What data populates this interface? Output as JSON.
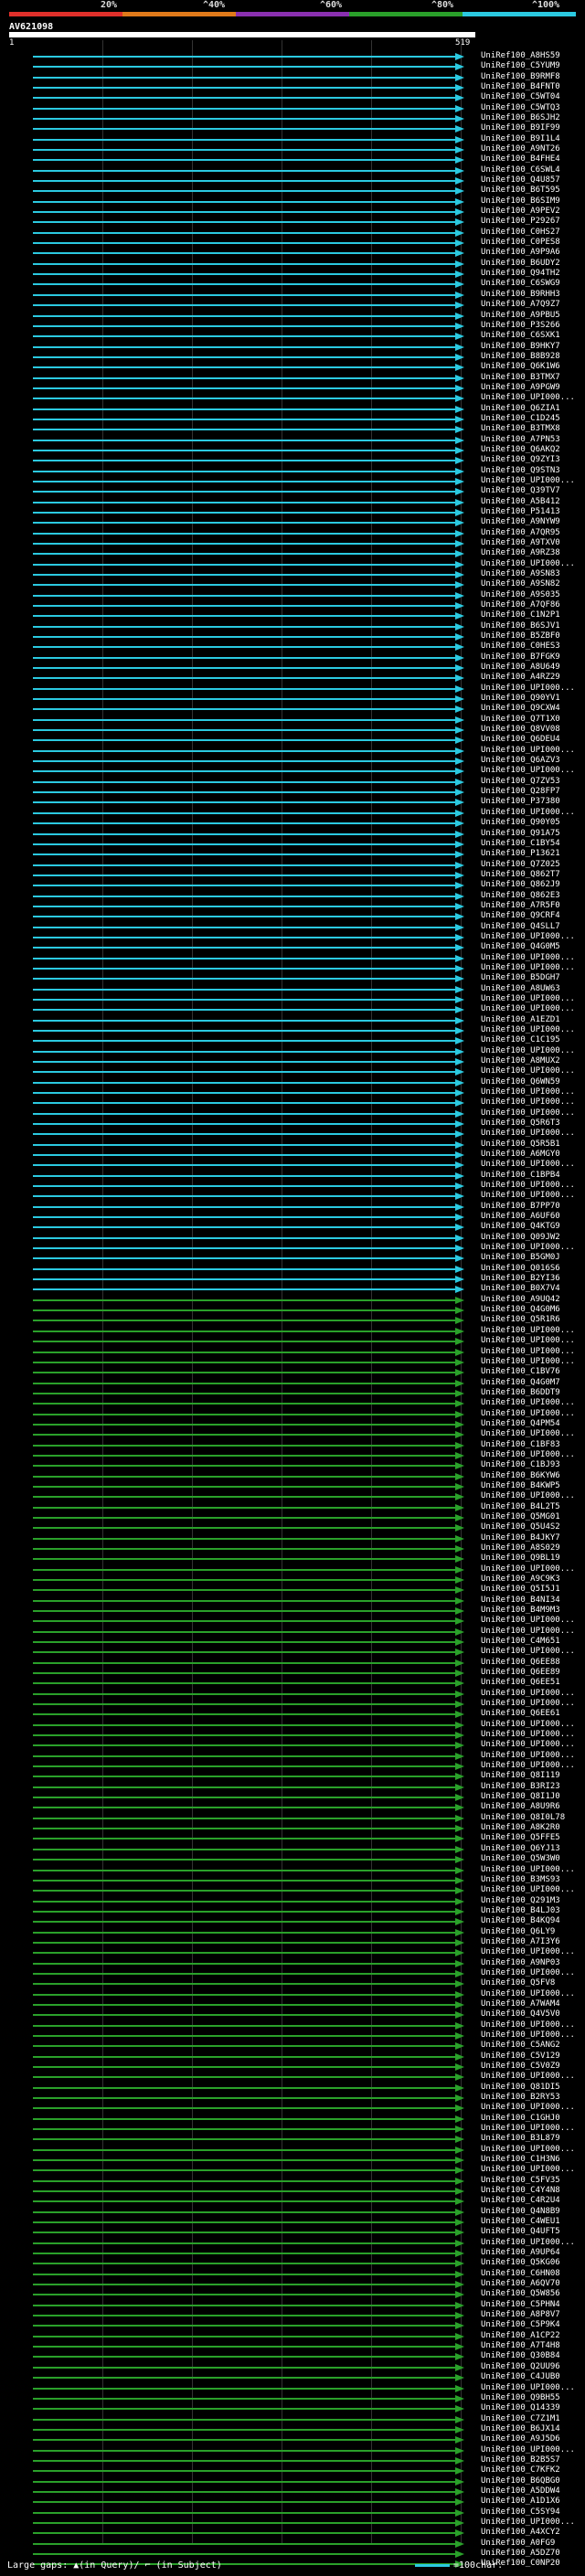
{
  "legend": {
    "labels": [
      "20%",
      "^40%",
      "^60%",
      "^80%",
      "^100%"
    ],
    "colors": [
      "#e0302b",
      "#e07a1a",
      "#8a30b0",
      "#2aa02a",
      "#2bc9e0"
    ]
  },
  "query": {
    "title": "AV621098",
    "start": "1",
    "end": "519"
  },
  "hits": [
    "UniRef100_A8HS59",
    "UniRef100_C5YUM9",
    "UniRef100_B9RMF8",
    "UniRef100_B4FNT0",
    "UniRef100_C5WT04",
    "UniRef100_C5WTQ3",
    "UniRef100_B6SJH2",
    "UniRef100_B9IF99",
    "UniRef100_B9I1L4",
    "UniRef100_A9NT26",
    "UniRef100_B4FHE4",
    "UniRef100_C6SWL4",
    "UniRef100_Q4U857",
    "UniRef100_B6T595",
    "UniRef100_B6SIM9",
    "UniRef100_A9PEV2",
    "UniRef100_P29267",
    "UniRef100_C0HS27",
    "UniRef100_C0PES8",
    "UniRef100_A9P9A6",
    "UniRef100_B6UDY2",
    "UniRef100_Q94TH2",
    "UniRef100_C6SWG9",
    "UniRef100_B9RHH3",
    "UniRef100_A7Q9Z7",
    "UniRef100_A9PBU5",
    "UniRef100_P3S266",
    "UniRef100_C6SXK1",
    "UniRef100_B9HKY7",
    "UniRef100_B8B928",
    "UniRef100_Q6K1W6",
    "UniRef100_B3TMX7",
    "UniRef100_A9PGW9",
    "UniRef100_UPI000...",
    "UniRef100_Q6ZIA1",
    "UniRef100_C1D245",
    "UniRef100_B3TMX8",
    "UniRef100_A7PN53",
    "UniRef100_Q6AKQ2",
    "UniRef100_Q9ZYI3",
    "UniRef100_Q9STN3",
    "UniRef100_UPI000...",
    "UniRef100_Q39TV7",
    "UniRef100_A5B412",
    "UniRef100_P51413",
    "UniRef100_A9NYW9",
    "UniRef100_A7QR95",
    "UniRef100_A9TXV0",
    "UniRef100_A9RZ38",
    "UniRef100_UPI000...",
    "UniRef100_A9SN83",
    "UniRef100_A9SN82",
    "UniRef100_A9S035",
    "UniRef100_A7QF86",
    "UniRef100_C1N2P1",
    "UniRef100_B6SJV1",
    "UniRef100_B5ZBF0",
    "UniRef100_C0HES3",
    "UniRef100_B7FGK9",
    "UniRef100_A8U649",
    "UniRef100_A4RZ29",
    "UniRef100_UPI000...",
    "UniRef100_Q90YV1",
    "UniRef100_Q9CXW4",
    "UniRef100_Q7T1X0",
    "UniRef100_Q8VV08",
    "UniRef100_Q6DEU4",
    "UniRef100_UPI000...",
    "UniRef100_Q6AZV3",
    "UniRef100_UPI000...",
    "UniRef100_Q7ZV53",
    "UniRef100_Q28FP7",
    "UniRef100_P37380",
    "UniRef100_UPI000...",
    "UniRef100_Q90Y05",
    "UniRef100_Q91A75",
    "UniRef100_C1BY54",
    "UniRef100_P13621",
    "UniRef100_Q7Z025",
    "UniRef100_Q862T7",
    "UniRef100_Q862J9",
    "UniRef100_Q862E3",
    "UniRef100_A7R5F0",
    "UniRef100_Q9CRF4",
    "UniRef100_Q4SLL7",
    "UniRef100_UPI000...",
    "UniRef100_Q4G0M5",
    "UniRef100_UPI000...",
    "UniRef100_UPI000...",
    "UniRef100_B5DGH7",
    "UniRef100_A8UW63",
    "UniRef100_UPI000...",
    "UniRef100_UPI000...",
    "UniRef100_A1EZD1",
    "UniRef100_UPI000...",
    "UniRef100_C1C195",
    "UniRef100_UPI000...",
    "UniRef100_A8MUX2",
    "UniRef100_UPI000...",
    "UniRef100_Q6WN59",
    "UniRef100_UPI000...",
    "UniRef100_UPI000...",
    "UniRef100_UPI000...",
    "UniRef100_Q5R6T3",
    "UniRef100_UPI000...",
    "UniRef100_Q5R5B1",
    "UniRef100_A6MGY0",
    "UniRef100_UPI000...",
    "UniRef100_C1BPB4",
    "UniRef100_UPI000...",
    "UniRef100_UPI000...",
    "UniRef100_B7PP70",
    "UniRef100_A6UF60",
    "UniRef100_Q4KTG9",
    "UniRef100_Q09JW2",
    "UniRef100_UPI000...",
    "UniRef100_B5GM0J",
    "UniRef100_Q016S6",
    "UniRef100_B2YI36",
    "UniRef100_B0X7V4",
    "UniRef100_A9UQ42",
    "UniRef100_Q4G0M6",
    "UniRef100_Q5R1R6",
    "UniRef100_UPI000...",
    "UniRef100_UPI000...",
    "UniRef100_UPI000...",
    "UniRef100_UPI000...",
    "UniRef100_C1BV76",
    "UniRef100_Q4G0M7",
    "UniRef100_B6DDT9",
    "UniRef100_UPI000...",
    "UniRef100_UPI000...",
    "UniRef100_Q4PM54",
    "UniRef100_UPI000...",
    "UniRef100_C1BF83",
    "UniRef100_UPI000...",
    "UniRef100_C1BJ93",
    "UniRef100_B6KYW6",
    "UniRef100_B4KWP5",
    "UniRef100_UPI000...",
    "UniRef100_B4L2T5",
    "UniRef100_Q5MG01",
    "UniRef100_Q5U4S2",
    "UniRef100_B4JKY7",
    "UniRef100_A8S029",
    "UniRef100_Q9BL19",
    "UniRef100_UPI000...",
    "UniRef100_A9C9K3",
    "UniRef100_Q5I5J1",
    "UniRef100_B4NI34",
    "UniRef100_B4M9M3",
    "UniRef100_UPI000...",
    "UniRef100_UPI000...",
    "UniRef100_C4M651",
    "UniRef100_UPI000...",
    "UniRef100_Q6EE88",
    "UniRef100_Q6EE89",
    "UniRef100_Q6EE51",
    "UniRef100_UPI000...",
    "UniRef100_UPI000...",
    "UniRef100_Q6EE61",
    "UniRef100_UPI000...",
    "UniRef100_UPI000...",
    "UniRef100_UPI000...",
    "UniRef100_UPI000...",
    "UniRef100_UPI000...",
    "UniRef100_Q8I119",
    "UniRef100_B3RI23",
    "UniRef100_Q8I1J0",
    "UniRef100_A8U9R6",
    "UniRef100_Q8I0L78",
    "UniRef100_A8K2R0",
    "UniRef100_Q5FFE5",
    "UniRef100_Q6YJ13",
    "UniRef100_Q5W3W0",
    "UniRef100_UPI000...",
    "UniRef100_B3MS93",
    "UniRef100_UPI000...",
    "UniRef100_Q291M3",
    "UniRef100_B4LJ03",
    "UniRef100_B4KQ94",
    "UniRef100_Q6LY9",
    "UniRef100_A7I3Y6",
    "UniRef100_UPI000...",
    "UniRef100_A9NP03",
    "UniRef100_UPI000...",
    "UniRef100_Q5FV8",
    "UniRef100_UPI000...",
    "UniRef100_A7WAM4",
    "UniRef100_Q4V5V0",
    "UniRef100_UPI000...",
    "UniRef100_UPI000...",
    "UniRef100_C5ANG2",
    "UniRef100_C5V129",
    "UniRef100_C5V0Z9",
    "UniRef100_UPI000...",
    "UniRef100_Q81DI5",
    "UniRef100_B2RY53",
    "UniRef100_UPI000...",
    "UniRef100_C1GHJ0",
    "UniRef100_UPI000...",
    "UniRef100_B3L879",
    "UniRef100_UPI000...",
    "UniRef100_C1H3N6",
    "UniRef100_UPI000...",
    "UniRef100_C5FV35",
    "UniRef100_C4Y4N8",
    "UniRef100_C4R2U4",
    "UniRef100_Q4N8B9",
    "UniRef100_C4WEU1",
    "UniRef100_Q4UFT5",
    "UniRef100_UPI000...",
    "UniRef100_A9UP64",
    "UniRef100_Q5KG06",
    "UniRef100_C6HN08",
    "UniRef100_A6QV70",
    "UniRef100_Q5W856",
    "UniRef100_C5PHN4",
    "UniRef100_A8P8V7",
    "UniRef100_C5P9K4",
    "UniRef100_A1CP22",
    "UniRef100_A7T4H8",
    "UniRef100_Q30B84",
    "UniRef100_Q2UU96",
    "UniRef100_C4JUB0",
    "UniRef100_UPI000...",
    "UniRef100_Q9BH55",
    "UniRef100_Q14339",
    "UniRef100_C7Z1M1",
    "UniRef100_B6JX14",
    "UniRef100_A9J5D6",
    "UniRef100_UPI000...",
    "UniRef100_B2B5S7",
    "UniRef100_C7KFK2",
    "UniRef100_B6QBG0",
    "UniRef100_A5DDW4",
    "UniRef100_A1D1X6",
    "UniRef100_C5SY94",
    "UniRef100_UPI000...",
    "UniRef100_A4XCY2",
    "UniRef100_A0FG9",
    "UniRef100_A5DZ70",
    "UniRef100_C0NP20"
  ],
  "footer": {
    "gaps_text": "Large gaps: ▲(in Query)/ ⌐ (in Subject)",
    "scale_text": "=100char."
  }
}
